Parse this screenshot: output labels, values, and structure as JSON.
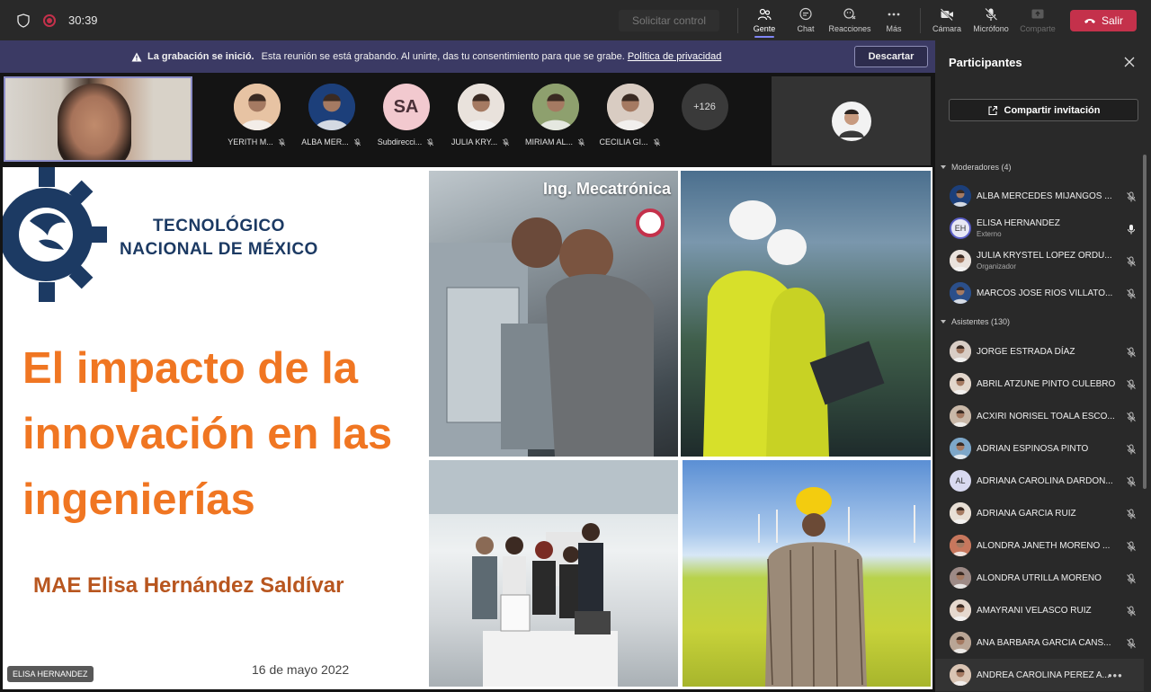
{
  "topbar": {
    "timer": "30:39",
    "request_control": "Solicitar control",
    "buttons": {
      "people": "Gente",
      "chat": "Chat",
      "reactions": "Reacciones",
      "more": "Más",
      "camera": "Cámara",
      "mic": "Micrófono",
      "share": "Comparte",
      "leave": "Salir"
    }
  },
  "banner": {
    "title": "La grabación se inició.",
    "message": "Esta reunión se está grabando. Al unirte, das tu consentimiento para que se grabe.",
    "link": "Política de privacidad",
    "dismiss": "Descartar"
  },
  "strip": {
    "participants": [
      {
        "name": "YERITH M...",
        "initials": "",
        "color": "#e7c3a3"
      },
      {
        "name": "ALBA MER...",
        "initials": "",
        "color": "#1c3f7a"
      },
      {
        "name": "Subdirecci...",
        "initials": "SA",
        "color": "#f2c9cf"
      },
      {
        "name": "JULIA KRY...",
        "initials": "",
        "color": "#e9e2dc"
      },
      {
        "name": "MIRIAM AL...",
        "initials": "",
        "color": "#8ea06e"
      },
      {
        "name": "CECILIA GI...",
        "initials": "",
        "color": "#d9ccc2"
      }
    ],
    "more_count": "+126"
  },
  "slide": {
    "institution_line1": "TECNOLÓGICO",
    "institution_line2": "NACIONAL DE MÉXICO",
    "title": "El impacto de la innovación en las ingenierías",
    "author": "MAE Elisa Hernández Saldívar",
    "date": "16 de mayo 2022",
    "photo_label": "Ing. Mecatrónica",
    "brand_color": "#f07622"
  },
  "speaker_tag": "ELISA HERNANDEZ",
  "panel": {
    "title": "Participantes",
    "invite": "Compartir invitación",
    "moderators_label": "Moderadores (4)",
    "attendees_label": "Asistentes (130)",
    "moderators": [
      {
        "name": "ALBA MERCEDES MIJANGOS ...",
        "sub": "",
        "initials": "",
        "color": "#1c3f7a",
        "mic": "off"
      },
      {
        "name": "ELISA HERNANDEZ",
        "sub": "Externo",
        "initials": "EH",
        "color": "#3a3f6b",
        "mic": "on"
      },
      {
        "name": "JULIA KRYSTEL LOPEZ ORDU...",
        "sub": "Organizador",
        "initials": "",
        "color": "#e9e2dc",
        "mic": "off"
      },
      {
        "name": "MARCOS JOSE RIOS VILLATO...",
        "sub": "",
        "initials": "",
        "color": "#2b4f8a",
        "mic": "off"
      }
    ],
    "attendees": [
      {
        "name": "JORGE ESTRADA DÍAZ",
        "initials": "",
        "color": "#d8cdc5"
      },
      {
        "name": "ABRIL ATZUNE PINTO CULEBRO",
        "initials": "",
        "color": "#e2d6cb"
      },
      {
        "name": "ACXIRI NORISEL TOALA ESCO...",
        "initials": "",
        "color": "#c9b8a8"
      },
      {
        "name": "ADRIAN ESPINOSA PINTO",
        "initials": "",
        "color": "#7da7c9"
      },
      {
        "name": "ADRIANA CAROLINA DARDON...",
        "initials": "AL",
        "color": "#d8d9f0"
      },
      {
        "name": "ADRIANA GARCIA RUIZ",
        "initials": "",
        "color": "#e8dfd5"
      },
      {
        "name": "ALONDRA JANETH MORENO ...",
        "initials": "",
        "color": "#c7775d"
      },
      {
        "name": "ALONDRA UTRILLA MORENO",
        "initials": "",
        "color": "#9d8a86"
      },
      {
        "name": "AMAYRANI VELASCO RUIZ",
        "initials": "",
        "color": "#e5d8ce"
      },
      {
        "name": "ANA BARBARA GARCIA CANS...",
        "initials": "",
        "color": "#b9a595"
      },
      {
        "name": "ANDREA CAROLINA PEREZ A...",
        "initials": "",
        "color": "#d9c4b3"
      }
    ]
  }
}
